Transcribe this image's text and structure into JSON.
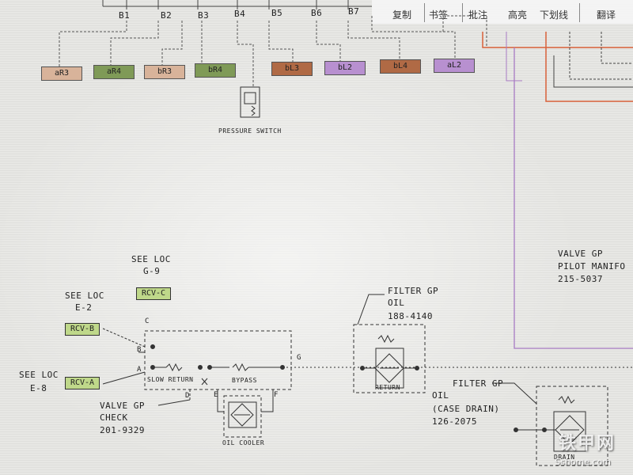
{
  "toolbar": {
    "items": [
      "复制",
      "书签",
      "批注",
      "高亮",
      "下划线",
      "翻译"
    ]
  },
  "bus_labels": [
    "B1",
    "B2",
    "B3",
    "B4",
    "B5",
    "B6",
    "B7"
  ],
  "ports": [
    {
      "label": "aR3",
      "color": "#d8b39a"
    },
    {
      "label": "aR4",
      "color": "#7f9a57"
    },
    {
      "label": "bR3",
      "color": "#d8b39a"
    },
    {
      "label": "bR4",
      "color": "#7f9a57"
    },
    {
      "label": "bL3",
      "color": "#b06a45"
    },
    {
      "label": "bL2",
      "color": "#b890d0"
    },
    {
      "label": "bL4",
      "color": "#b06a45"
    },
    {
      "label": "aL2",
      "color": "#b890d0"
    }
  ],
  "pressure_switch": "PRESSURE SWITCH",
  "refs": {
    "g9": {
      "see": "SEE LOC",
      "loc": "G-9",
      "rcv": "RCV-C"
    },
    "e2": {
      "see": "SEE LOC",
      "loc": "E-2",
      "rcv": "RCV-B"
    },
    "e8": {
      "see": "SEE LOC",
      "loc": "E-8",
      "rcv": "RCV-A"
    }
  },
  "check_valve": {
    "ports": {
      "a": "A",
      "b": "B",
      "c": "C",
      "d": "D",
      "e": "E",
      "f": "F",
      "g": "G"
    },
    "slow_return": "SLOW RETURN",
    "bypass": "BYPASS",
    "line1": "VALVE GP",
    "line2": "CHECK",
    "part": "201-9329"
  },
  "oil_cooler": "OIL COOLER",
  "filter_oil": {
    "line1": "FILTER GP",
    "line2": "OIL",
    "part": "188-4140",
    "return": "RETURN"
  },
  "filter_case": {
    "line1": "FILTER GP",
    "line2": "OIL",
    "line3": "(CASE DRAIN)",
    "part": "126-2075",
    "inner": "DRAIN"
  },
  "pilot_manifold": {
    "line1": "VALVE GP",
    "line2": "PILOT MANIFO",
    "part": "215-5037"
  },
  "watermark": {
    "brand": "铁甲网",
    "url": "Sshome.com"
  },
  "colors": {
    "bg": "#e7e7e4",
    "purple": "#a87bc4",
    "orange": "#d9603a",
    "line": "#333333"
  }
}
